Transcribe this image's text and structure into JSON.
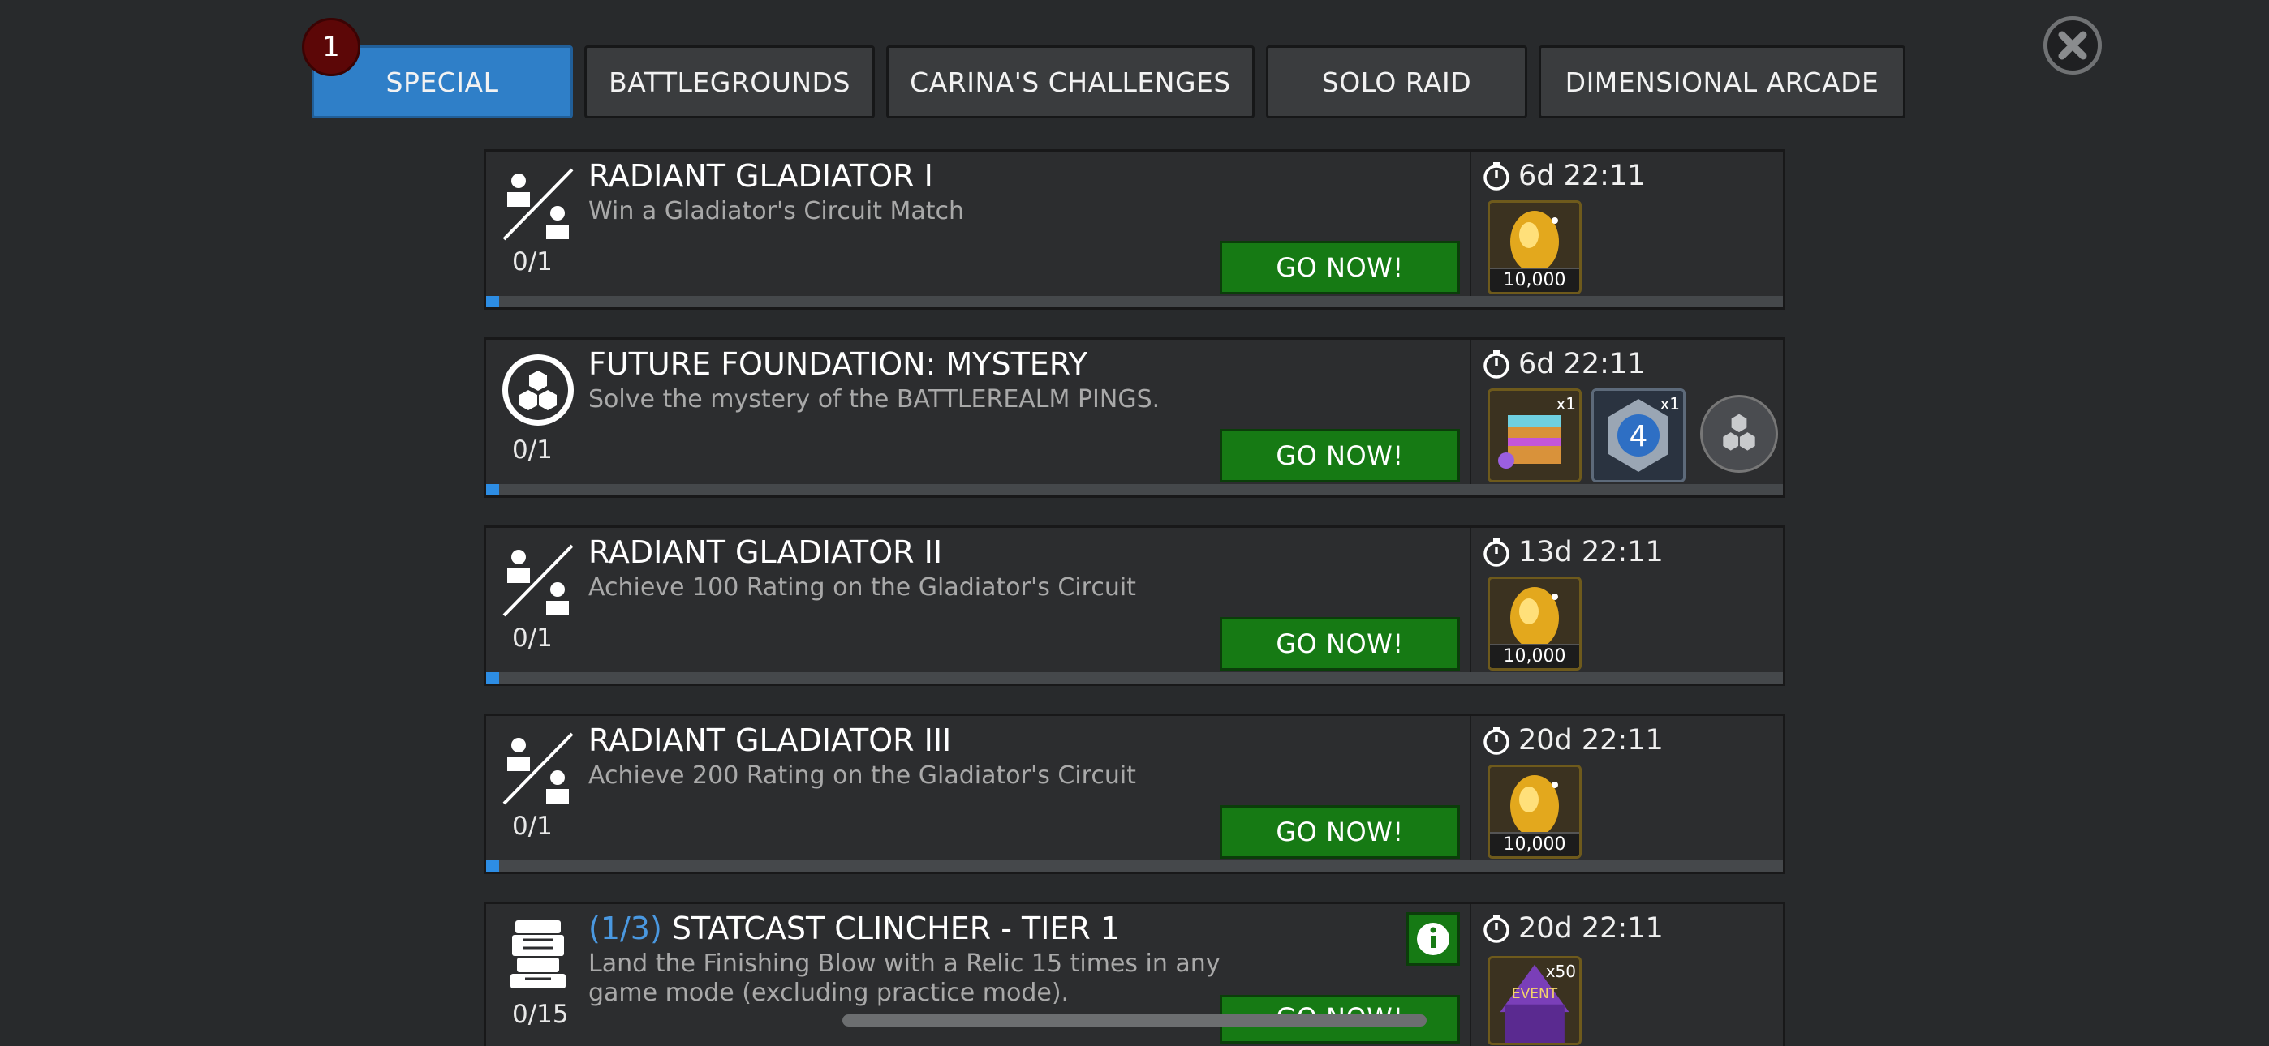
{
  "tabs": [
    {
      "label": "SPECIAL",
      "active": true
    },
    {
      "label": "BATTLEGROUNDS",
      "active": false
    },
    {
      "label": "CARINA'S CHALLENGES",
      "active": false
    },
    {
      "label": "SOLO RAID",
      "active": false
    },
    {
      "label": "DIMENSIONAL ARCADE",
      "active": false
    }
  ],
  "notification_badge": "1",
  "quests": [
    {
      "title": "RADIANT GLADIATOR I",
      "description": "Win a Gladiator's Circuit Match",
      "progress": "0/1",
      "progress_fraction": 0.01,
      "button": "GO NOW!",
      "timer": "6d 22:11",
      "icon": "gladiator-versus-icon",
      "rewards": [
        {
          "icon": "radiant-gold-crystal",
          "amount": "10,000"
        }
      ]
    },
    {
      "title": "FUTURE FOUNDATION: MYSTERY",
      "description": "Solve the mystery of the BATTLEREALM PINGS.",
      "progress": "0/1",
      "progress_fraction": 0.01,
      "button": "GO NOW!",
      "timer": "6d 22:11",
      "icon": "hexagon-cluster-icon",
      "rewards": [
        {
          "icon": "rainbow-crystal",
          "qty": "x1"
        },
        {
          "icon": "fantastic-four-crystal",
          "qty": "x1"
        },
        {
          "icon": "silver-hexagon-token"
        }
      ]
    },
    {
      "title": "RADIANT GLADIATOR II",
      "description": "Achieve 100 Rating on the Gladiator's Circuit",
      "progress": "0/1",
      "progress_fraction": 0.01,
      "button": "GO NOW!",
      "timer": "13d 22:11",
      "icon": "gladiator-versus-icon",
      "rewards": [
        {
          "icon": "radiant-gold-crystal",
          "amount": "10,000"
        }
      ]
    },
    {
      "title": "RADIANT GLADIATOR III",
      "description": "Achieve 200 Rating on the Gladiator's Circuit",
      "progress": "0/1",
      "progress_fraction": 0.01,
      "button": "GO NOW!",
      "timer": "20d 22:11",
      "icon": "gladiator-versus-icon",
      "rewards": [
        {
          "icon": "radiant-gold-crystal",
          "amount": "10,000"
        }
      ]
    },
    {
      "title_prefix": "(1/3)",
      "title": "STATCAST CLINCHER - TIER 1",
      "description": "Land the Finishing Blow with a Relic 15 times in any game mode (excluding practice mode).",
      "progress": "0/15",
      "button": "GO NOW!",
      "timer": "20d 22:11",
      "icon": "relic-totem-icon",
      "rewards": [
        {
          "icon": "event-token",
          "qty": "x50",
          "label": "EVENT"
        }
      ]
    }
  ],
  "colors": {
    "background": "#282a2c",
    "active_tab": "#2f7fc8",
    "go_button": "#167a14",
    "progress_fill": "#2d8de4",
    "title_prefix": "#4a98e0"
  }
}
